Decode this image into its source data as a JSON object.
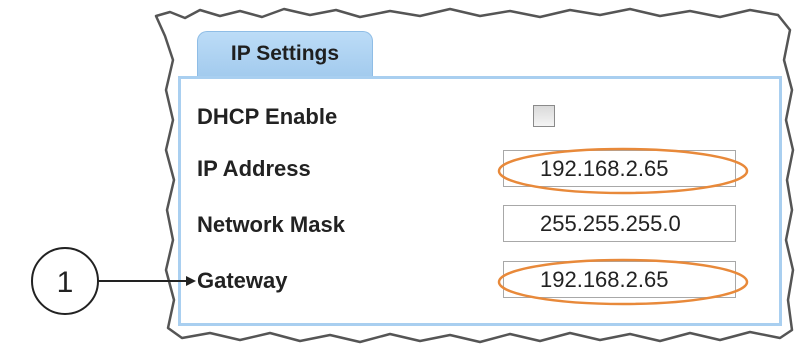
{
  "tab": {
    "label": "IP Settings"
  },
  "rows": {
    "dhcp": {
      "label": "DHCP Enable",
      "checked": false
    },
    "ip_address": {
      "label": "IP Address",
      "value": "192.168.2.65"
    },
    "network_mask": {
      "label": "Network Mask",
      "value": "255.255.255.0"
    },
    "gateway": {
      "label": "Gateway",
      "value": "192.168.2.65"
    }
  },
  "callout": {
    "number": "1"
  },
  "colors": {
    "tab_blue": "#a3cbee",
    "panel_border": "#a9cff0",
    "highlight_ellipse": "#e8893a"
  }
}
